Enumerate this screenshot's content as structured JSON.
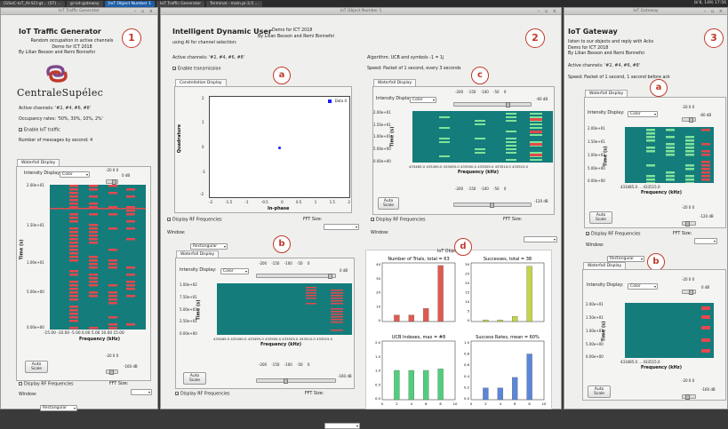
{
  "taskbar": {
    "tasks": [
      "[GSoC-IoT_AI-SCI-gt... (ST) ...",
      "gr-iot-gateway",
      "[IoT Object Number 1",
      "IoT Traffic Generator",
      "Terminal - main.pi-3.5 ..."
    ],
    "sysinfo": "(b'8, 149) 17:56"
  },
  "left": {
    "titlebar": "IoT Traffic Generator",
    "title": "IoT Traffic Generator",
    "circle": "1",
    "desc1": "Random occupation in active channels",
    "desc2": "Demo for ICT 2018",
    "desc3": "By Lilian Besson and Remi Bonnefoi",
    "logo": "CentraleSupélec",
    "channels": "Active channels: '#2, #4, #6, #8'",
    "occupancy": "Occupancy rates: '50%, 30%, 10%, 2%'",
    "enable": "Enable IoT traffic",
    "msgs": "Number of messages by second: 4",
    "wf_tab": "Waterfall Display",
    "intensity": "Intensity Display:",
    "color": "Color",
    "top_db": "0 dB",
    "knob_lbl": "-20 0 0",
    "yticks": [
      "2.00e+01",
      "1.50e+01",
      "1.00e+01",
      "5.00e+00",
      "0.00e+00"
    ],
    "xticks": "-15.00 -10.00 -5.00 0.00 5.00 10.00 15.00",
    "ylabel": "Time (s)",
    "xlabel": "Frequency (kHz)",
    "autoscale": "Auto Scale",
    "bot_db": "-160 dB",
    "display_rf": "Display RF Frequencies",
    "fft": "FFT Size:",
    "window": "Window:",
    "rect": "Rectangular"
  },
  "middle": {
    "titlebar": "IoT Object Number 1",
    "title": "Intelligent Dynamic User",
    "title2": "Demo for ICT 2018",
    "title3": "By Lilian Besson and Remi Bonnefoi",
    "circle": "2",
    "using": "using AI for channel selection:",
    "channels": "Active channels: '#2, #4, #6, #8'",
    "algorithm": "Algorithm: UCB and symbols -1 = 1j",
    "enable_tx": "Enable transmission",
    "speed": "Speed: Packet of 1 second, every 3 seconds",
    "circle_a": "a",
    "circle_b": "b",
    "circle_c": "c",
    "circle_d": "d",
    "const_tab": "Constellation Display",
    "const_legend": "Data 0",
    "const_yticks": [
      "2",
      "1.5",
      "1",
      "0.5",
      "0",
      "-0.5",
      "-1",
      "-1.5",
      "-2"
    ],
    "const_xticks": [
      "-2",
      "-1.5",
      "-1",
      "-0.5",
      "0",
      "0.5",
      "1",
      "1.5",
      "2"
    ],
    "const_xlabel": "In-phase",
    "const_ylabel": "Quadrature",
    "display_rf": "Display RF Frequencies",
    "fft": "FFT Size:",
    "window": "Window:",
    "rect": "Rectangular",
    "wf_tab": "Waterfall Display",
    "intensity": "Intensity Display:",
    "color": "Color",
    "scale": "-200 -150 -100 -50 0",
    "top_db": "0 dB",
    "top_db_c": "-60 dB",
    "bot_db": "-160 dB",
    "bot_db_c": "-120 dB",
    "wf_c_yticks": [
      "2.00e+01",
      "1.50e+01",
      "1.00e+01",
      "5.00e+00",
      "0.00e+00"
    ],
    "wf_c_xticks": "433485.0 433490.0 433495.0 433500.0 433505.0 433510.0 433515.0",
    "wf_b_yticks": [
      "1.00e+02",
      "7.50e+01",
      "5.00e+01",
      "2.50e+01",
      "0.00e+00"
    ],
    "wf_b_xticks": "433485.0 433490.0 433495.0 433500.0 433505.0 433510.0 433515.0",
    "ylabel": "Time (s)",
    "xlabel": "Frequency (kHz)",
    "autoscale": "Auto Scale",
    "iot_objects": "IoT Objects",
    "charts": [
      {
        "title": "Number of Trials, total = 63",
        "yticks": [
          "40",
          "30",
          "20",
          "10",
          "0"
        ],
        "values": [
          5,
          5,
          10,
          43
        ],
        "color": "#e05a4f"
      },
      {
        "title": "Successes, total = 38",
        "yticks": [
          "30",
          "25",
          "20",
          "15",
          "10",
          "5",
          "0"
        ],
        "values": [
          1,
          1,
          3,
          33
        ],
        "color": "#c3d44a"
      },
      {
        "title": "UCB Indexes, max = #8",
        "yticks": [
          "2.0",
          "1.5",
          "1.0",
          "0.5",
          "0.0"
        ],
        "values": [
          1.0,
          1.0,
          1.0,
          1.05
        ],
        "color": "#4fcf7d"
      },
      {
        "title": "Success Rates, mean = 60%",
        "yticks": [
          "1.0",
          "0.8",
          "0.6",
          "0.4",
          "0.2",
          "0.0"
        ],
        "values": [
          0.2,
          0.2,
          0.38,
          0.78
        ],
        "color": "#5a86d8"
      }
    ],
    "bar_xticks": [
      "0",
      "2",
      "4",
      "6",
      "8",
      "10"
    ]
  },
  "right": {
    "titlebar": "IoT Gateway",
    "title": "IoT Gateway",
    "circle": "3",
    "circle_a": "a",
    "circle_b": "b",
    "desc1": "listen to our objects and reply with Acks",
    "desc2": "Demo for ICT 2018",
    "desc3": "By Lilian Besson and Remi Bonnefoi",
    "channels": "Active channels: '#2, #4, #6, #8'",
    "speed": "Speed: Packet of 1 second, 1 second before ack",
    "wf_tab": "Waterfall Display",
    "intensity": "Intensity Display:",
    "color": "Color",
    "top_db": "-60 dB",
    "top_db_b": "0 dB",
    "bot_db": "-120 dB",
    "bot_db_b": "-160 dB",
    "yticks": [
      "2.00e+01",
      "1.50e+01",
      "1.00e+01",
      "5.00e+00",
      "0.00e+00"
    ],
    "xticks": "433485.0 ... 433515.0",
    "ylabel": "Time (s)",
    "xlabel": "Frequency (kHz)",
    "autoscale": "Auto Scale",
    "display_rf": "Display RF Frequencies",
    "fft": "FFT Size:",
    "window": "Window:",
    "rect": "Rectangular",
    "knob_lbl": "-20 0 0"
  },
  "chart_data": [
    {
      "type": "bar",
      "title": "Number of Trials, total = 63",
      "x": [
        2,
        4,
        6,
        8
      ],
      "values": [
        5,
        5,
        10,
        43
      ],
      "ylim": [
        0,
        45
      ]
    },
    {
      "type": "bar",
      "title": "Successes, total = 38",
      "x": [
        2,
        4,
        6,
        8
      ],
      "values": [
        1,
        1,
        3,
        33
      ],
      "ylim": [
        0,
        35
      ]
    },
    {
      "type": "bar",
      "title": "UCB Indexes, max = #8",
      "x": [
        2,
        4,
        6,
        8
      ],
      "values": [
        1.0,
        1.0,
        1.0,
        1.05
      ],
      "ylim": [
        0,
        2
      ]
    },
    {
      "type": "bar",
      "title": "Success Rates, mean = 60%",
      "x": [
        2,
        4,
        6,
        8
      ],
      "values": [
        0.2,
        0.2,
        0.38,
        0.78
      ],
      "ylim": [
        0,
        1
      ]
    }
  ]
}
